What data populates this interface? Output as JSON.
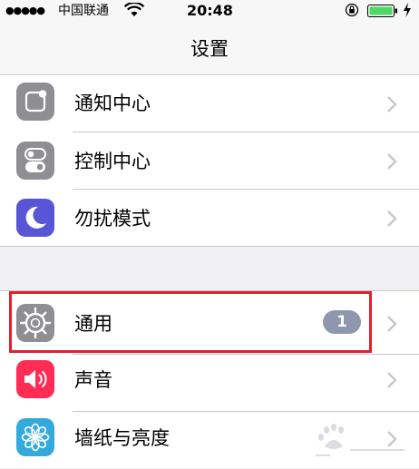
{
  "status_bar": {
    "signal_dots": "●●●●●",
    "carrier": "中国联通",
    "time": "20:48",
    "icons": [
      "wifi-icon",
      "orientation-lock-icon",
      "battery-icon",
      "charging-bolt-icon"
    ]
  },
  "nav": {
    "title": "设置"
  },
  "groups": [
    {
      "items": [
        {
          "label": "通知中心",
          "icon": "notification-center-icon",
          "icon_color": "#8e8e93"
        },
        {
          "label": "控制中心",
          "icon": "control-center-icon",
          "icon_color": "#8e8e93"
        },
        {
          "label": "勿扰模式",
          "icon": "moon-icon",
          "icon_color": "#5856d6"
        }
      ]
    },
    {
      "items": [
        {
          "label": "通用",
          "icon": "gear-icon",
          "icon_color": "#8e8e93",
          "badge": "1"
        },
        {
          "label": "声音",
          "icon": "speaker-icon",
          "icon_color": "#ff2d55"
        },
        {
          "label": "墙纸与亮度",
          "icon": "flower-icon",
          "icon_color": "#34aadc"
        }
      ]
    }
  ],
  "colors": {
    "highlight": "#e0202f",
    "badge": "#8e97ad",
    "background": "#efeff4"
  }
}
